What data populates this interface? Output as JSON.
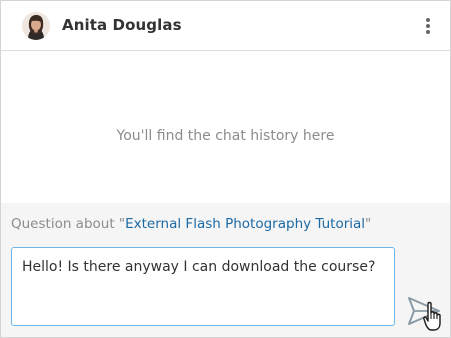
{
  "header": {
    "contact_name": "Anita Douglas",
    "avatar_icon": "user-avatar-icon",
    "menu_icon": "kebab-menu-icon"
  },
  "history": {
    "placeholder": "You'll find the chat history here"
  },
  "composer": {
    "context_prefix": "Question about \"",
    "course_title": "External Flash Photography Tutorial",
    "context_suffix": "\"",
    "message_value": "Hello! Is there anyway I can download the course?",
    "send_icon": "paper-plane-icon",
    "cursor_icon": "hand-pointer-icon"
  },
  "colors": {
    "accent_link": "#1d6aa5",
    "input_border": "#6fb6e6",
    "muted_text": "#8c8c8c",
    "composer_bg": "#f5f5f5"
  }
}
